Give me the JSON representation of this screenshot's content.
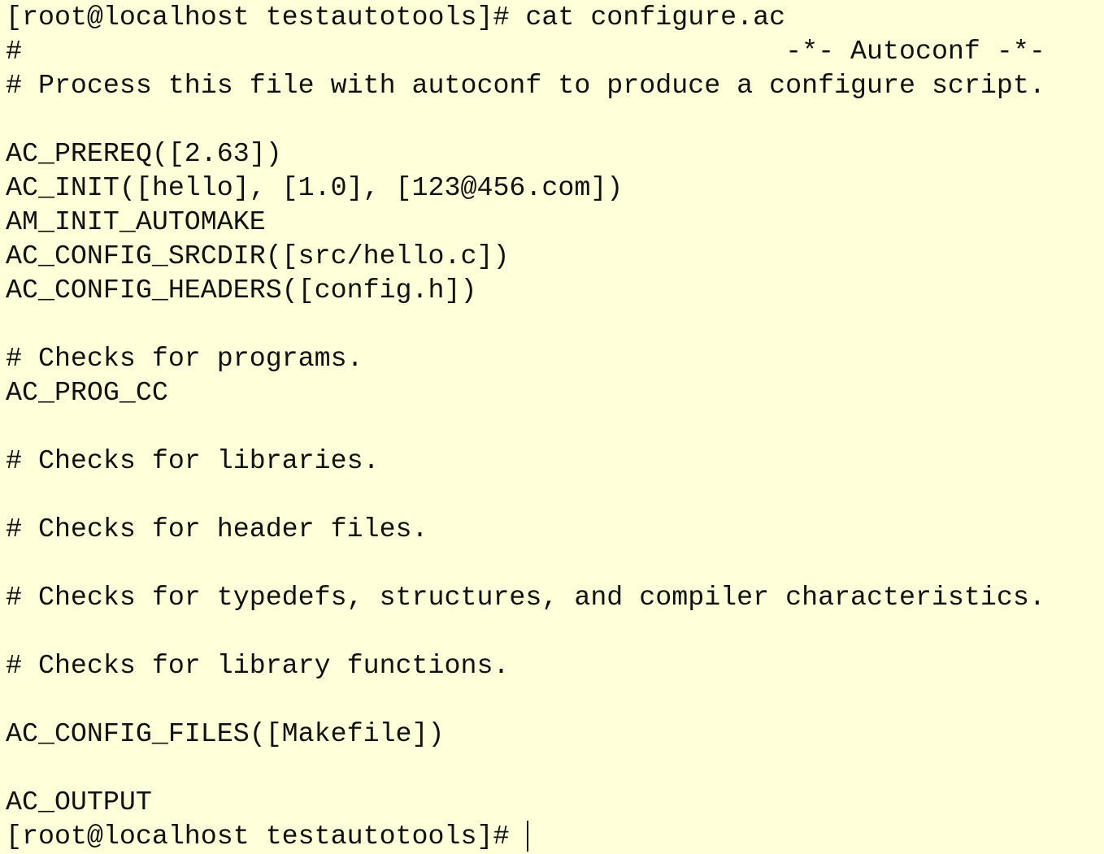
{
  "terminal": {
    "lines": [
      "[root@localhost testautotools]# cat configure.ac",
      "#                                               -*- Autoconf -*-",
      "# Process this file with autoconf to produce a configure script.",
      "",
      "AC_PREREQ([2.63])",
      "AC_INIT([hello], [1.0], [123@456.com])",
      "AM_INIT_AUTOMAKE",
      "AC_CONFIG_SRCDIR([src/hello.c])",
      "AC_CONFIG_HEADERS([config.h])",
      "",
      "# Checks for programs.",
      "AC_PROG_CC",
      "",
      "# Checks for libraries.",
      "",
      "# Checks for header files.",
      "",
      "# Checks for typedefs, structures, and compiler characteristics.",
      "",
      "# Checks for library functions.",
      "",
      "AC_CONFIG_FILES([Makefile])",
      "",
      "AC_OUTPUT"
    ],
    "prompt": "[root@localhost testautotools]# ",
    "colors": {
      "background": "#ffffd9",
      "text": "#111111"
    }
  }
}
